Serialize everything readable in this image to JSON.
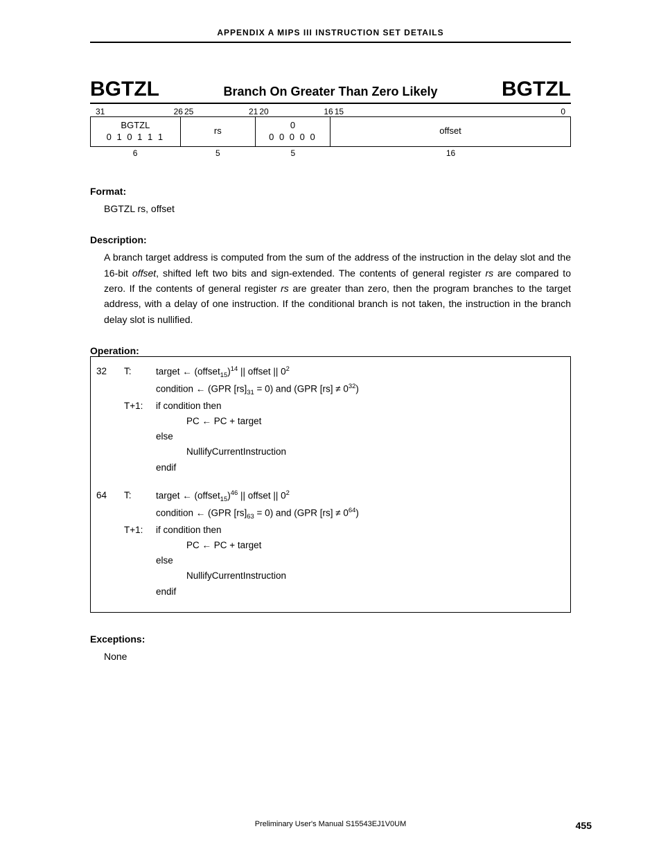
{
  "header": {
    "appendix": "APPENDIX  A   MIPS  III  INSTRUCTION  SET  DETAILS"
  },
  "instruction": {
    "mnemonic_left": "BGTZL",
    "title": "Branch On Greater Than Zero Likely",
    "mnemonic_right": "BGTZL"
  },
  "encoding": {
    "bits": {
      "b31": "31",
      "b26": "26",
      "b25": "25",
      "b21": "21",
      "b20": "20",
      "b16": "16",
      "b15": "15",
      "b0": "0"
    },
    "fields": [
      {
        "top": "BGTZL",
        "bot": "0 1 0 1 1 1",
        "width": "6"
      },
      {
        "top": "rs",
        "bot": "",
        "width": "5"
      },
      {
        "top": "0",
        "bot": "0 0 0 0 0",
        "width": "5"
      },
      {
        "top": "offset",
        "bot": "",
        "width": "16"
      }
    ]
  },
  "format": {
    "label": "Format:",
    "text": "BGTZL rs, offset"
  },
  "description": {
    "label": "Description:",
    "p1a": "A branch target address is computed from the sum of the address of the instruction in the delay slot and the 16-bit ",
    "p1_offset": "offset",
    "p1b": ", shifted left two bits and sign-extended.  The contents of general register ",
    "p1_rs1": "rs",
    "p1c": " are compared to zero.  If the contents of general register ",
    "p1_rs2": "rs",
    "p1d": " are greater than zero, then the program branches to the target address, with a delay of one instruction.  If the conditional branch is not taken, the instruction in the branch delay slot is nullified."
  },
  "operation": {
    "label": "Operation:",
    "mode32": "32",
    "mode64": "64",
    "T": "T:",
    "T1": "T+1:",
    "line_target_a": "target ← (offset",
    "line_target_sub": "15",
    "line_target_b": ")",
    "line_target_sup32": "14",
    "line_target_sup64": "46",
    "line_target_c": " || offset || 0",
    "line_target_sup2": "2",
    "cond_a": "condition ← (GPR [rs]",
    "cond_sub32": "31",
    "cond_sub64": "63",
    "cond_b": " = 0) and (GPR [rs] ≠ 0",
    "cond_sup32": "32",
    "cond_sup64": "64",
    "cond_c": ")",
    "if": "if condition then",
    "pc": "PC ← PC + target",
    "else": "else",
    "nullify": "NullifyCurrentInstruction",
    "endif": "endif"
  },
  "exceptions": {
    "label": "Exceptions:",
    "text": "None"
  },
  "footer": {
    "center": "Preliminary User's Manual  S15543EJ1V0UM",
    "page": "455"
  }
}
